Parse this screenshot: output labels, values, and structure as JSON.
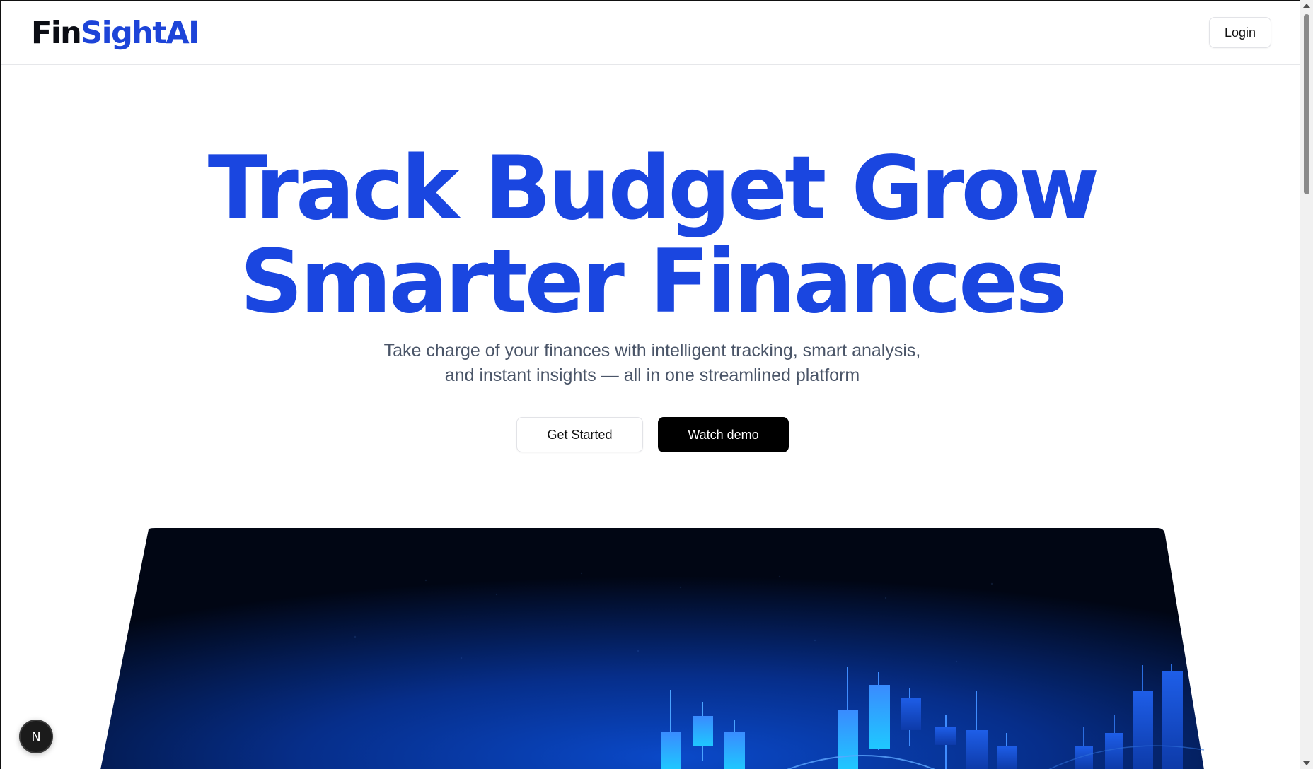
{
  "brand": {
    "name_part1": "Fin",
    "name_part2": "SightAI",
    "accent_color": "#1d44d8"
  },
  "navbar": {
    "login_label": "Login"
  },
  "hero": {
    "title_line1": "Track Budget Grow",
    "title_line2": "Smarter Finances",
    "title_color": "#1a46e0",
    "subtitle_line1": "Take charge of your finances with intelligent tracking, smart analysis,",
    "subtitle_line2": "and instant insights — all in one streamlined platform",
    "get_started_label": "Get Started",
    "watch_demo_label": "Watch demo"
  },
  "dev_badge": {
    "label": "N",
    "icon": "nextjs-logo-icon"
  },
  "hero_image": {
    "description_icon": "candlestick-chart-graphic",
    "background_color": "#020a22"
  }
}
